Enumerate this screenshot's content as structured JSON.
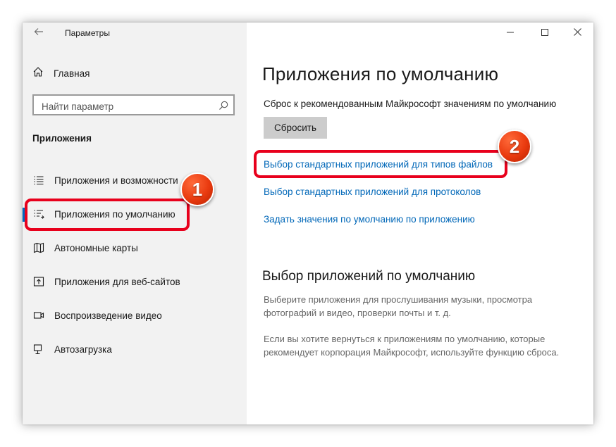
{
  "window": {
    "title": "Параметры",
    "controls": [
      "minimize",
      "maximize",
      "close"
    ]
  },
  "sidebar": {
    "home_label": "Главная",
    "search_placeholder": "Найти параметр",
    "section_title": "Приложения",
    "items": [
      {
        "label": "Приложения и возможности",
        "icon": "apps-features-icon",
        "active": false
      },
      {
        "label": "Приложения по умолчанию",
        "icon": "default-apps-icon",
        "active": true
      },
      {
        "label": "Автономные карты",
        "icon": "offline-maps-icon",
        "active": false
      },
      {
        "label": "Приложения для веб-сайтов",
        "icon": "apps-websites-icon",
        "active": false
      },
      {
        "label": "Воспроизведение видео",
        "icon": "video-playback-icon",
        "active": false
      },
      {
        "label": "Автозагрузка",
        "icon": "startup-icon",
        "active": false
      }
    ]
  },
  "main": {
    "page_title": "Приложения по умолчанию",
    "reset_description": "Сброс к рекомендованным Майкрософт значениям по умолчанию",
    "reset_button": "Сбросить",
    "links": [
      "Выбор стандартных приложений для типов файлов",
      "Выбор стандартных приложений для протоколов",
      "Задать значения по умолчанию по приложению"
    ],
    "subsection_title": "Выбор приложений по умолчанию",
    "paragraph_1": "Выберите приложения для прослушивания музыки, просмотра фотографий и видео, проверки почты и т. д.",
    "paragraph_2": "Если вы хотите вернуться к приложениям по умолчанию, которые рекомендует корпорация Майкрософт, используйте функцию сброса."
  },
  "annotations": {
    "badge_1": "1",
    "badge_2": "2",
    "highlight_color": "#e8001c",
    "badge_color": "#e93a0f"
  },
  "colors": {
    "accent": "#0067c0",
    "link": "#0067b8",
    "sidebar_bg": "#f2f2f2"
  }
}
